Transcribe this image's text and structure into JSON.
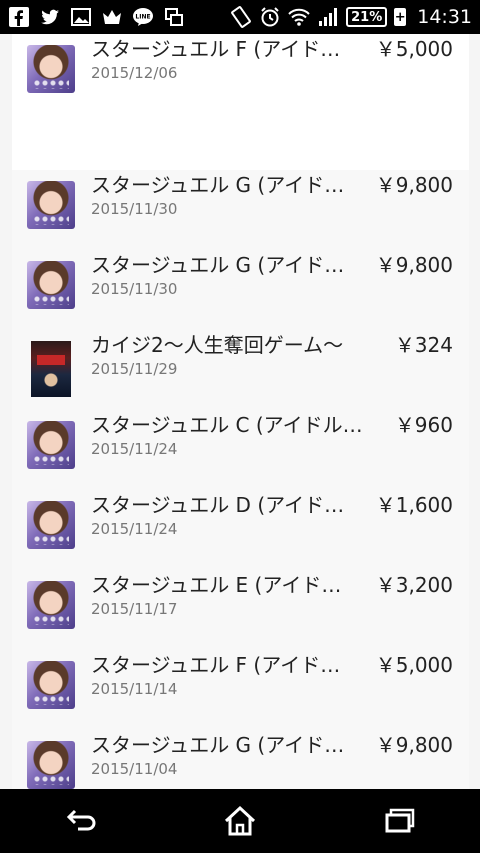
{
  "status_bar": {
    "left_icons": [
      "facebook-icon",
      "twitter-icon",
      "gallery-icon",
      "crown-icon",
      "line-icon",
      "multiwindow-icon"
    ],
    "right_icons": [
      "rotate-icon",
      "alarm-icon",
      "wifi-icon",
      "signal-icon"
    ],
    "battery_percent": "21%",
    "battery_charging_symbol": "+",
    "time": "14:31"
  },
  "purchases_top": [
    {
      "title": "スタージュエル F (アイド…",
      "price": "￥5,000",
      "date": "2015/12/06",
      "thumb": "anime"
    }
  ],
  "purchases": [
    {
      "title": "スタージュエル G (アイド…",
      "price": "￥9,800",
      "date": "2015/11/30",
      "thumb": "anime"
    },
    {
      "title": "スタージュエル G (アイド…",
      "price": "￥9,800",
      "date": "2015/11/30",
      "thumb": "anime"
    },
    {
      "title": "カイジ2〜人生奪回ゲーム〜",
      "price": "￥324",
      "date": "2015/11/29",
      "thumb": "kaiji"
    },
    {
      "title": "スタージュエル C (アイドル…",
      "price": "￥960",
      "date": "2015/11/24",
      "thumb": "anime"
    },
    {
      "title": "スタージュエル D (アイド…",
      "price": "￥1,600",
      "date": "2015/11/24",
      "thumb": "anime"
    },
    {
      "title": "スタージュエル E (アイド…",
      "price": "￥3,200",
      "date": "2015/11/17",
      "thumb": "anime"
    },
    {
      "title": "スタージュエル F (アイド…",
      "price": "￥5,000",
      "date": "2015/11/14",
      "thumb": "anime"
    },
    {
      "title": "スタージュエル G (アイド…",
      "price": "￥9,800",
      "date": "2015/11/04",
      "thumb": "anime"
    }
  ],
  "nav_bar": {
    "buttons": [
      "back-icon",
      "home-icon",
      "recents-icon"
    ]
  }
}
